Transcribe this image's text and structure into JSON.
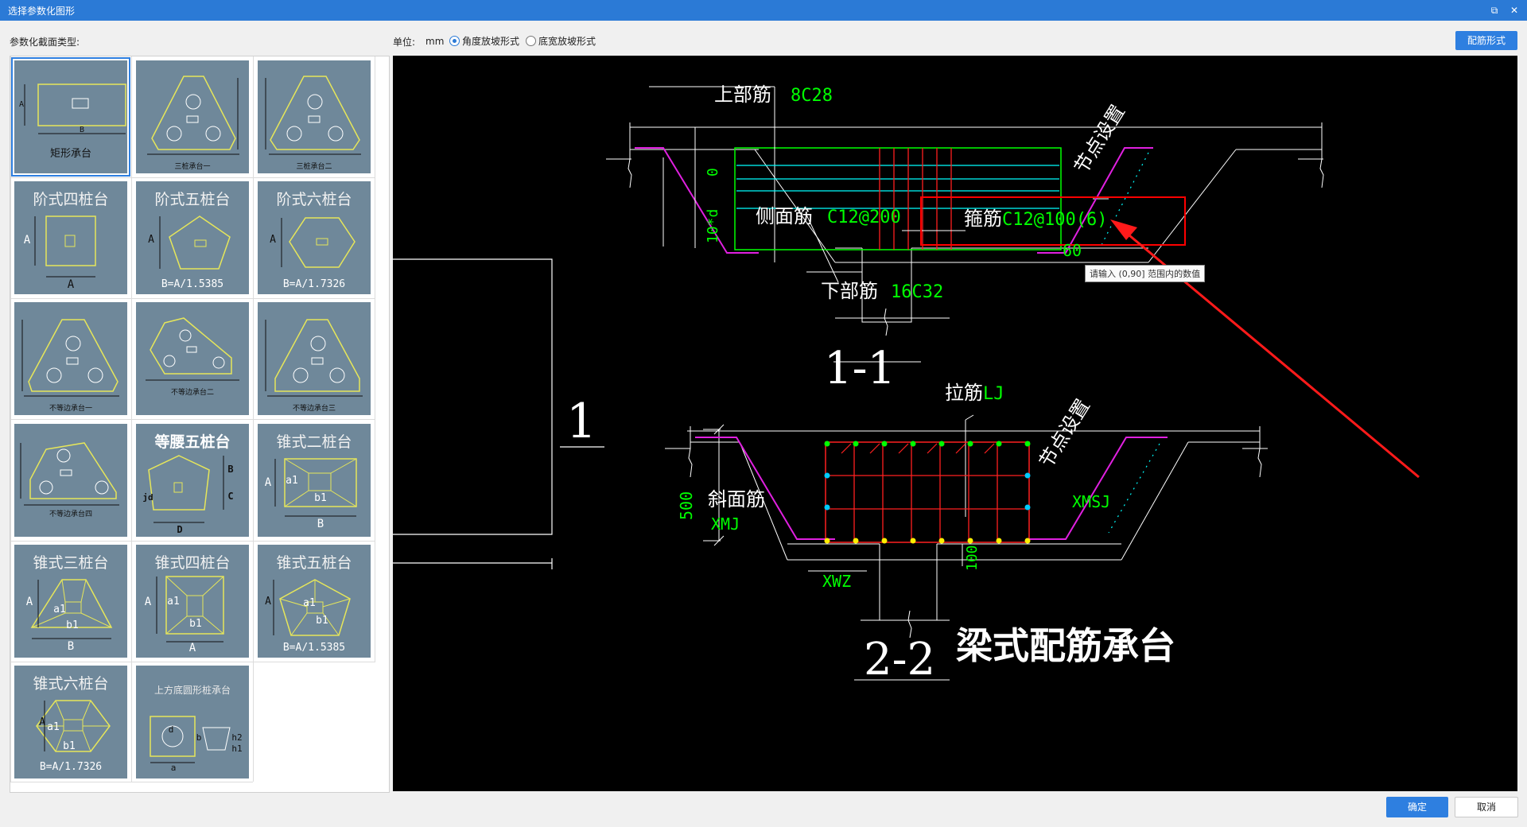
{
  "window": {
    "title": "选择参数化图形",
    "restore_icon": "restore-icon",
    "close_icon": "close-icon"
  },
  "toolbar": {
    "section_label": "参数化截面类型:",
    "unit_label": "单位:",
    "unit_value": "mm",
    "radio_angle_label": "角度放坡形式",
    "radio_width_label": "底宽放坡形式",
    "selected_radio": "角度放坡形式",
    "rebar_form_button": "配筋形式"
  },
  "gallery": {
    "tiles": [
      {
        "title": "",
        "caption": "矩形承台",
        "labels": [
          "A",
          "B"
        ]
      },
      {
        "title": "",
        "caption": "三桩承台一",
        "labels": []
      },
      {
        "title": "",
        "caption": "三桩承台二",
        "labels": []
      },
      {
        "title": "阶式四桩台",
        "caption": "",
        "labels": [
          "A",
          "A"
        ]
      },
      {
        "title": "阶式五桩台",
        "caption": "B=A/1.5385",
        "labels": [
          "A"
        ]
      },
      {
        "title": "阶式六桩台",
        "caption": "B=A/1.7326",
        "labels": [
          "A"
        ]
      },
      {
        "title": "",
        "caption": "不等边承台一",
        "labels": []
      },
      {
        "title": "",
        "caption": "不等边承台二",
        "labels": []
      },
      {
        "title": "",
        "caption": "不等边承台三",
        "labels": []
      },
      {
        "title": "",
        "caption": "不等边承台四",
        "labels": []
      },
      {
        "title": "等腰五桩台",
        "caption": "",
        "labels": [
          "B",
          "C",
          "D",
          "jd"
        ]
      },
      {
        "title": "锥式二桩台",
        "caption": "",
        "labels": [
          "A",
          "a1",
          "b1",
          "B"
        ]
      },
      {
        "title": "锥式三桩台",
        "caption": "",
        "labels": [
          "A",
          "a1",
          "b1",
          "B"
        ]
      },
      {
        "title": "锥式四桩台",
        "caption": "",
        "labels": [
          "A",
          "a1",
          "b1",
          "A"
        ]
      },
      {
        "title": "锥式五桩台",
        "caption": "B=A/1.5385",
        "labels": [
          "A",
          "a1",
          "b1"
        ]
      },
      {
        "title": "锥式六桩台",
        "caption": "B=A/1.7326",
        "labels": [
          "A",
          "a1",
          "b1"
        ]
      },
      {
        "title": "上方底圆形桩承台",
        "caption": "",
        "labels": [
          "d",
          "b",
          "a",
          "h2",
          "h1"
        ]
      }
    ]
  },
  "preview": {
    "section1_title": "1-1",
    "section2_title": "2-2",
    "plan_label": "1",
    "figure_title": "梁式配筋承台",
    "top_rebar_label": "上部筋",
    "top_rebar_value": "8C28",
    "side_rebar_label": "侧面筋",
    "side_rebar_value": "C12@200",
    "stirrup_label": "箍筋",
    "stirrup_value": "C12@100(6)",
    "bottom_rebar_label": "下部筋",
    "bottom_rebar_value": "16C32",
    "node_setting_1": "节点设置",
    "node_setting_2": "节点设置",
    "angle_value": "60",
    "dim_zero": "0",
    "dim_10d": "10*d",
    "tie_label": "拉筋",
    "tie_value": "LJ",
    "slope_rebar_label": "斜面筋",
    "slope_rebar_value": "XMJ",
    "xmsj": "XMSJ",
    "xwz": "XWZ",
    "dim_500": "500",
    "dim_100": "100",
    "tooltip": "请输入 (0,90] 范围内的数值"
  },
  "footer": {
    "ok_button": "确定",
    "cancel_button": "取消"
  },
  "colors": {
    "accent": "#2e7fe0",
    "titlebar": "#2b7ad6",
    "tile_bg": "#6f889a",
    "cad_bg": "#000000",
    "rebar_red": "#ff2020",
    "rebar_green": "#00ff00",
    "highlight": "#ff0000"
  }
}
